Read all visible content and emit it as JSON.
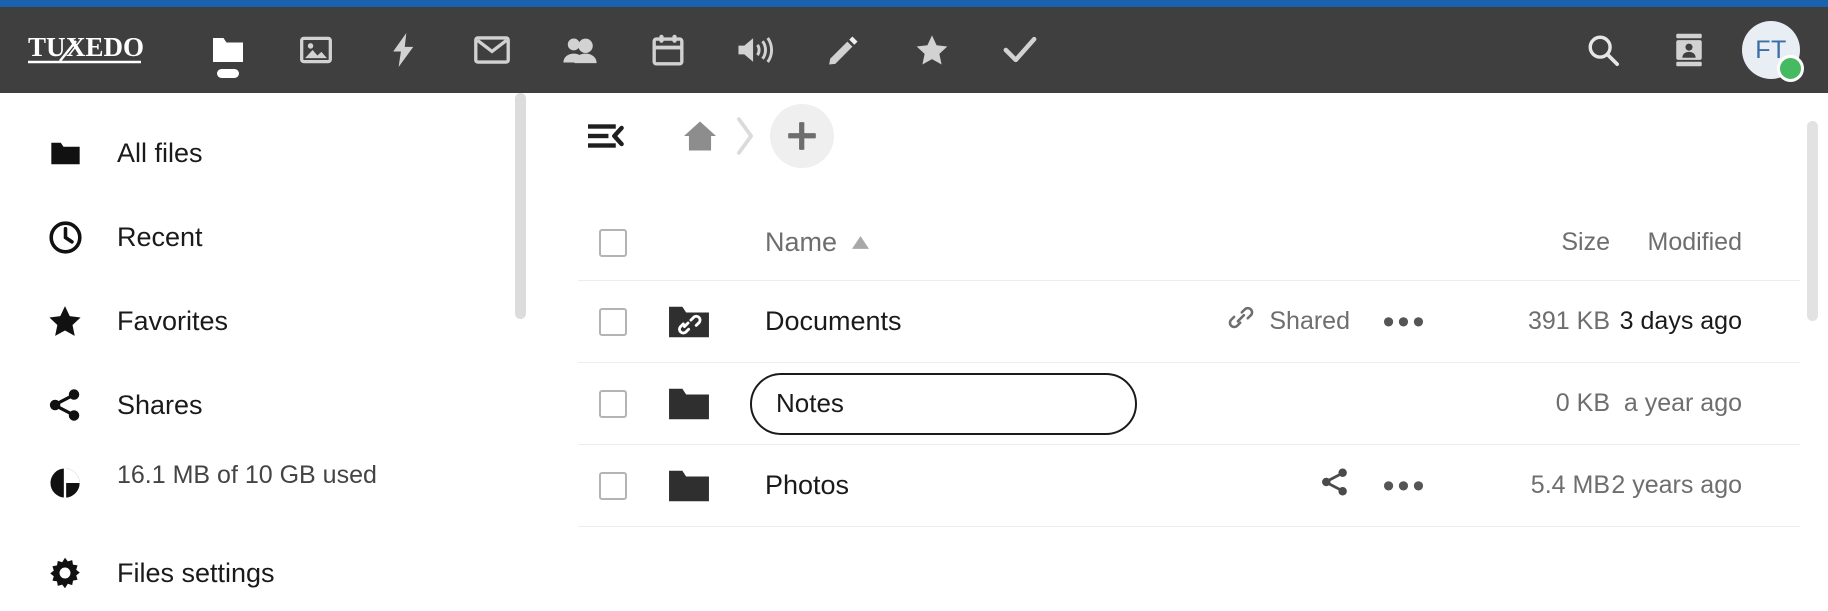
{
  "theme": {
    "accent_bar_color": "#1a62ad",
    "header_bg": "#3f3f3f",
    "avatar_text_color": "#3a6ea5",
    "status_online_color": "#46ba61"
  },
  "header": {
    "logo_text": "TUXEDO",
    "apps": [
      {
        "name": "files-app",
        "icon": "folder-icon",
        "label": "Files",
        "active": true
      },
      {
        "name": "photos-app",
        "icon": "photos-icon",
        "label": "Photos",
        "active": false
      },
      {
        "name": "activity-app",
        "icon": "lightning-icon",
        "label": "Activity",
        "active": false
      },
      {
        "name": "mail-app",
        "icon": "envelope-icon",
        "label": "Mail",
        "active": false
      },
      {
        "name": "contacts-app",
        "icon": "people-icon",
        "label": "Contacts",
        "active": false
      },
      {
        "name": "calendar-app",
        "icon": "calendar-icon",
        "label": "Calendar",
        "active": false
      },
      {
        "name": "talk-app",
        "icon": "speaker-icon",
        "label": "Talk",
        "active": false
      },
      {
        "name": "notes-app",
        "icon": "pencil-icon",
        "label": "Notes",
        "active": false
      },
      {
        "name": "bookmarks-app",
        "icon": "star-icon",
        "label": "Bookmarks",
        "active": false
      },
      {
        "name": "tasks-app",
        "icon": "check-icon",
        "label": "Tasks",
        "active": false
      }
    ],
    "search_icon": "search-icon",
    "contacts_menu_icon": "contacts-card-icon",
    "avatar_initials": "FT",
    "avatar_status": "online"
  },
  "sidebar": {
    "items": [
      {
        "label": "All files",
        "icon": "folder-icon"
      },
      {
        "label": "Recent",
        "icon": "clock-icon"
      },
      {
        "label": "Favorites",
        "icon": "star-icon"
      },
      {
        "label": "Shares",
        "icon": "share-icon"
      }
    ],
    "storage": {
      "label": "16.1 MB of 10 GB used",
      "icon": "pie-chart-icon",
      "percent": 1
    },
    "settings": {
      "label": "Files settings",
      "icon": "gear-icon"
    }
  },
  "toolbar": {
    "collapse_icon": "collapse-sidebar-icon",
    "home_icon": "home-icon",
    "separator_icon": "chevron-right-icon",
    "add_icon": "plus-icon",
    "add_label": "+"
  },
  "file_table": {
    "columns": {
      "name": "Name",
      "size": "Size",
      "modified": "Modified"
    },
    "sort": {
      "column": "Name",
      "direction": "asc",
      "icon": "arrow-up-icon"
    },
    "rows": [
      {
        "name": "Documents",
        "icon": "folder-link-icon",
        "shared_label": "Shared",
        "shared_icon": "link-icon",
        "has_actions": true,
        "actions_label": "•••",
        "size": "391 KB",
        "modified": "3 days ago",
        "modified_emphasis": true,
        "renaming": false
      },
      {
        "name": "Notes",
        "icon": "folder-icon",
        "shared_label": "",
        "shared_icon": "",
        "has_actions": false,
        "actions_label": "",
        "size": "0 KB",
        "modified": "a year ago",
        "modified_emphasis": false,
        "renaming": true
      },
      {
        "name": "Photos",
        "icon": "folder-icon",
        "shared_label": "",
        "shared_icon": "share-icon",
        "has_actions": true,
        "actions_label": "•••",
        "size": "5.4 MB",
        "modified": "2 years ago",
        "modified_emphasis": false,
        "renaming": false
      }
    ]
  }
}
